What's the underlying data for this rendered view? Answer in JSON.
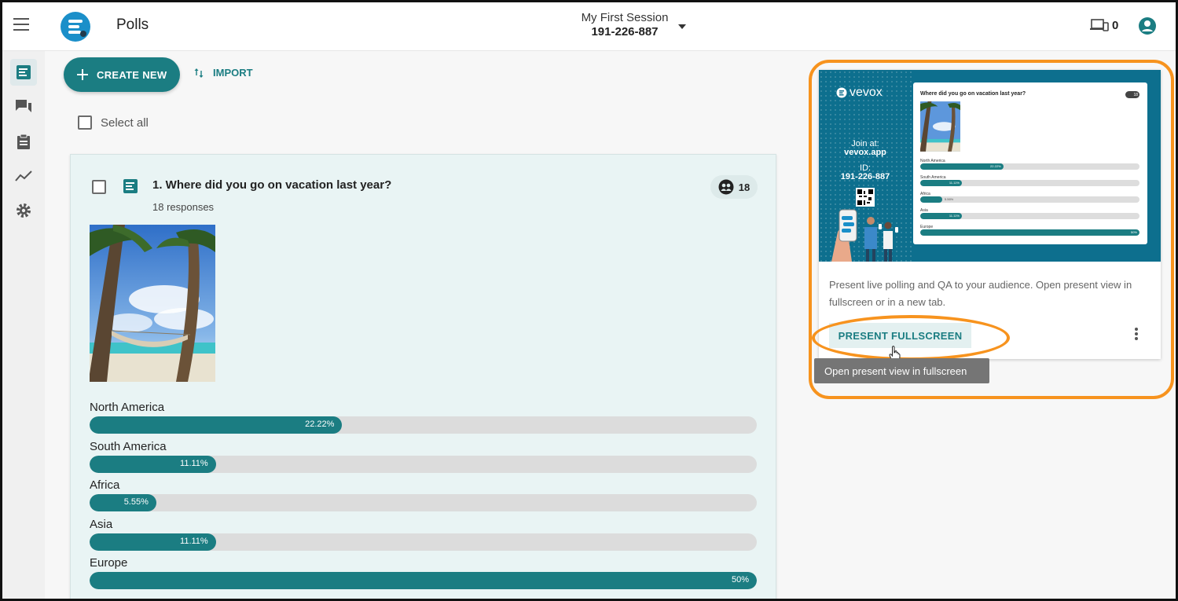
{
  "header": {
    "app_title": "Polls",
    "session_name": "My First Session",
    "session_id": "191-226-887",
    "device_count": "0"
  },
  "icons": {
    "menu": "hamburger-icon",
    "logo": "vevox-logo-icon",
    "devices": "devices-icon",
    "account": "account-circle-icon",
    "rail": [
      "polls-icon",
      "qa-icon",
      "survey-icon",
      "analytics-icon",
      "settings-icon"
    ]
  },
  "toolbar": {
    "create_label": "CREATE NEW",
    "import_label": "IMPORT",
    "select_all_label": "Select all"
  },
  "poll": {
    "question": "1. Where did you go on vacation last year?",
    "responses_text": "18 responses",
    "participant_count": "18",
    "options": [
      {
        "label": "North America",
        "pct_text": "22.22%",
        "value": 22.22
      },
      {
        "label": "South America",
        "pct_text": "11.11%",
        "value": 11.11
      },
      {
        "label": "Africa",
        "pct_text": "5.55%",
        "value": 5.55
      },
      {
        "label": "Asia",
        "pct_text": "11.11%",
        "value": 11.11
      },
      {
        "label": "Europe",
        "pct_text": "50%",
        "value": 50
      }
    ]
  },
  "present": {
    "brand": "vevox",
    "join_at": "Join at:",
    "join_url": "vevox.app",
    "id_label": "ID:",
    "id_value": "191-226-887",
    "preview_question": "Where did you go on vacation last year?",
    "preview_count": "18",
    "preview_options": [
      {
        "label": "North America",
        "pct_text": "22.22%",
        "value": 22.22
      },
      {
        "label": "South America",
        "pct_text": "11.11%",
        "value": 11.11
      },
      {
        "label": "Africa",
        "pct_text": "5.56%",
        "value": 5.56
      },
      {
        "label": "Asia",
        "pct_text": "11.11%",
        "value": 11.11
      },
      {
        "label": "Europe",
        "pct_text": "50%",
        "value": 50
      }
    ],
    "description": "Present live polling and QA to your audience. Open present view in fullscreen or in a new tab.",
    "fullscreen_label": "PRESENT FULLSCREEN",
    "tooltip": "Open present view in fullscreen"
  },
  "colors": {
    "accent": "#1b7d82",
    "highlight": "#f7931e",
    "preview_bg": "#0d6f8e"
  }
}
